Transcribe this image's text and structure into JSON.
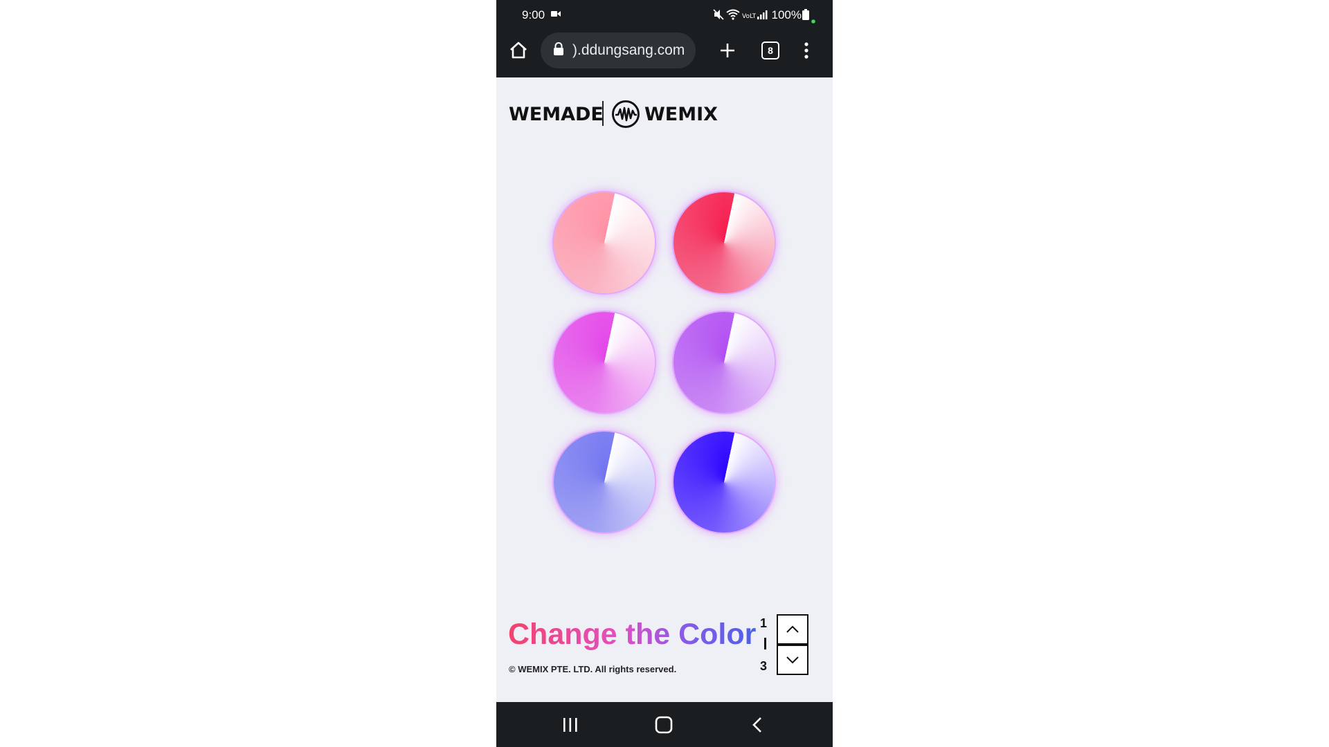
{
  "status_bar": {
    "time": "9:00",
    "battery": "100%"
  },
  "browser": {
    "url": ").ddungsang.com",
    "tab_count": "8"
  },
  "logo": {
    "left_word": "WEMADE",
    "right_word": "WEMIX"
  },
  "dials": [
    {
      "name": "light-pink",
      "color": "#ff8fa3"
    },
    {
      "name": "red",
      "color": "#f5194b"
    },
    {
      "name": "magenta",
      "color": "#e342e8"
    },
    {
      "name": "violet",
      "color": "#b04bf2"
    },
    {
      "name": "periwinkle",
      "color": "#6f72f0"
    },
    {
      "name": "blue",
      "color": "#2a00ff"
    }
  ],
  "footer": {
    "headline": "Change the Color",
    "copyright": "© WEMIX PTE. LTD. All rights reserved.",
    "page_current": "1",
    "page_total": "3"
  },
  "colors": {
    "system_bar": "#1b1e21",
    "page_background": "#efeff6",
    "headline_gradient": [
      "#f4426e",
      "#e14fbf",
      "#8a5ae8",
      "#4b60e8"
    ]
  }
}
